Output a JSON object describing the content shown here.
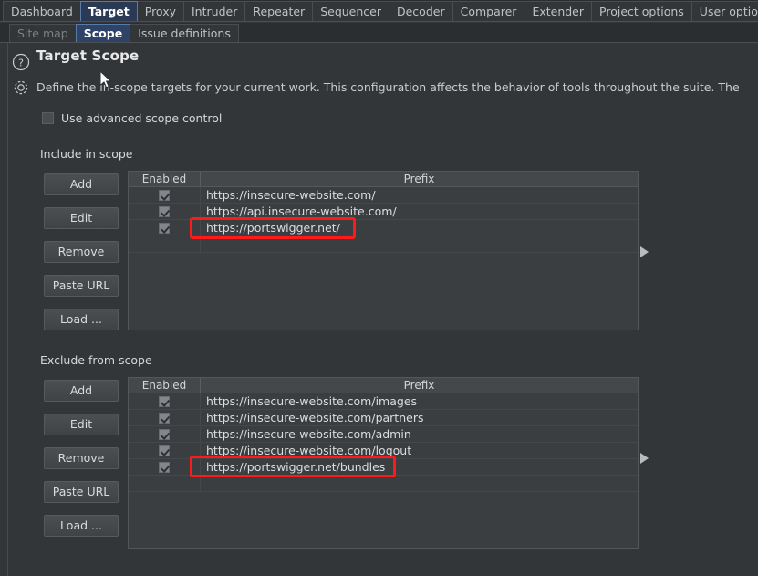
{
  "tabs": [
    {
      "label": "Dashboard",
      "active": false
    },
    {
      "label": "Target",
      "active": true
    },
    {
      "label": "Proxy",
      "active": false
    },
    {
      "label": "Intruder",
      "active": false
    },
    {
      "label": "Repeater",
      "active": false
    },
    {
      "label": "Sequencer",
      "active": false
    },
    {
      "label": "Decoder",
      "active": false
    },
    {
      "label": "Comparer",
      "active": false
    },
    {
      "label": "Extender",
      "active": false
    },
    {
      "label": "Project options",
      "active": false
    },
    {
      "label": "User options",
      "active": false
    }
  ],
  "subtabs": [
    {
      "label": "Site map",
      "active": false,
      "disabled": true
    },
    {
      "label": "Scope",
      "active": true,
      "disabled": false
    },
    {
      "label": "Issue definitions",
      "active": false,
      "disabled": false
    }
  ],
  "page": {
    "title": "Target Scope",
    "description": "Define the in-scope targets for your current work. This configuration affects the behavior of tools throughout the suite. The",
    "help_icon": "question-circle-icon",
    "settings_icon": "gear-icon"
  },
  "advanced_control": {
    "label": "Use advanced scope control",
    "checked": false
  },
  "include_section": {
    "label": "Include in scope",
    "buttons": [
      {
        "label": "Add"
      },
      {
        "label": "Edit"
      },
      {
        "label": "Remove"
      },
      {
        "label": "Paste URL"
      },
      {
        "label": "Load ..."
      }
    ],
    "columns": [
      "Enabled",
      "Prefix"
    ],
    "rows": [
      {
        "enabled": true,
        "prefix": "https://insecure-website.com/",
        "highlighted": false
      },
      {
        "enabled": true,
        "prefix": "https://api.insecure-website.com/",
        "highlighted": false
      },
      {
        "enabled": true,
        "prefix": "https://portswigger.net/",
        "highlighted": true
      }
    ]
  },
  "exclude_section": {
    "label": "Exclude from scope",
    "buttons": [
      {
        "label": "Add"
      },
      {
        "label": "Edit"
      },
      {
        "label": "Remove"
      },
      {
        "label": "Paste URL"
      },
      {
        "label": "Load ..."
      }
    ],
    "columns": [
      "Enabled",
      "Prefix"
    ],
    "rows": [
      {
        "enabled": true,
        "prefix": "https://insecure-website.com/images",
        "highlighted": false
      },
      {
        "enabled": true,
        "prefix": "https://insecure-website.com/partners",
        "highlighted": false
      },
      {
        "enabled": true,
        "prefix": "https://insecure-website.com/admin",
        "highlighted": false
      },
      {
        "enabled": true,
        "prefix": "https://insecure-website.com/logout",
        "highlighted": false
      },
      {
        "enabled": true,
        "prefix": "https://portswigger.net/bundles",
        "highlighted": true
      }
    ]
  },
  "colors": {
    "background": "#333638",
    "tabbar": "#2b2e31",
    "active_tab": "#2a3a55",
    "table_bg": "#3b3e41",
    "table_header": "#45484b",
    "highlight": "#ff1a1a",
    "text": "#d5d8da"
  }
}
